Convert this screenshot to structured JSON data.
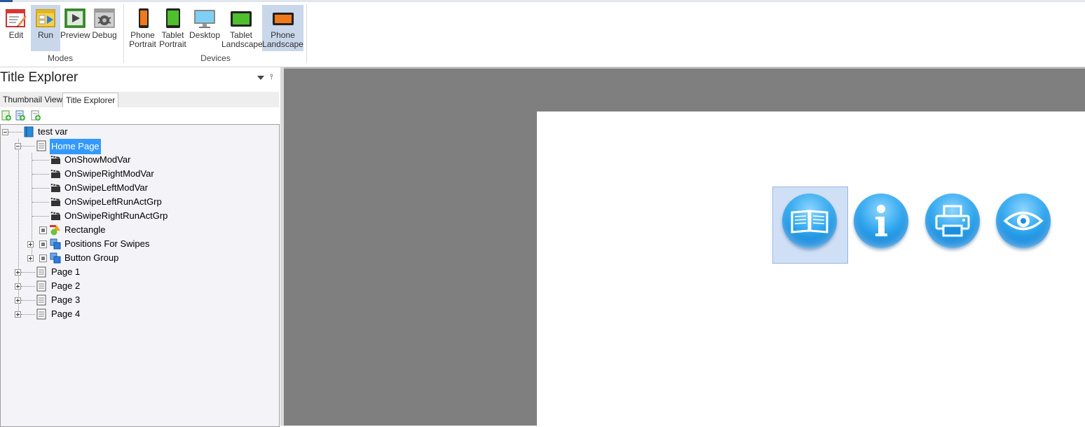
{
  "ribbon": {
    "modes": {
      "group_label": "Modes",
      "buttons": [
        {
          "label": "Edit",
          "icon": "edit-icon"
        },
        {
          "label": "Run",
          "icon": "run-icon",
          "active": true
        },
        {
          "label": "Preview",
          "icon": "preview-icon"
        },
        {
          "label": "Debug",
          "icon": "debug-icon"
        }
      ]
    },
    "devices": {
      "group_label": "Devices",
      "buttons": [
        {
          "line1": "Phone",
          "line2": "Portrait",
          "icon": "phone-portrait-icon"
        },
        {
          "line1": "Tablet",
          "line2": "Portrait",
          "icon": "tablet-portrait-icon"
        },
        {
          "line1": "Desktop",
          "line2": "",
          "icon": "desktop-icon"
        },
        {
          "line1": "Tablet",
          "line2": "Landscape",
          "icon": "tablet-landscape-icon"
        },
        {
          "line1": "Phone",
          "line2": "Landscape",
          "icon": "phone-landscape-icon",
          "active": true
        }
      ]
    }
  },
  "panel": {
    "title": "Title Explorer",
    "tabs": [
      "Thumbnail View",
      "Title Explorer"
    ],
    "active_tab": "Title Explorer"
  },
  "tree": {
    "root": "test var",
    "home": "Home Page",
    "actions": [
      "OnShowModVar",
      "OnSwipeRightModVar",
      "OnSwipeLeftModVar",
      "OnSwipeLeftRunActGrp",
      "OnSwipeRightRunActGrp"
    ],
    "objects": [
      "Rectangle",
      "Positions For Swipes",
      "Button Group"
    ],
    "pages": [
      "Page 1",
      "Page 2",
      "Page 3",
      "Page 4"
    ]
  },
  "canvas": {
    "buttons": [
      "book-icon",
      "info-icon",
      "printer-icon",
      "eye-icon"
    ],
    "colors": {
      "orb": "#1a8fe0",
      "background": "#7f7f7f",
      "selection": "#cfe0f6"
    }
  }
}
